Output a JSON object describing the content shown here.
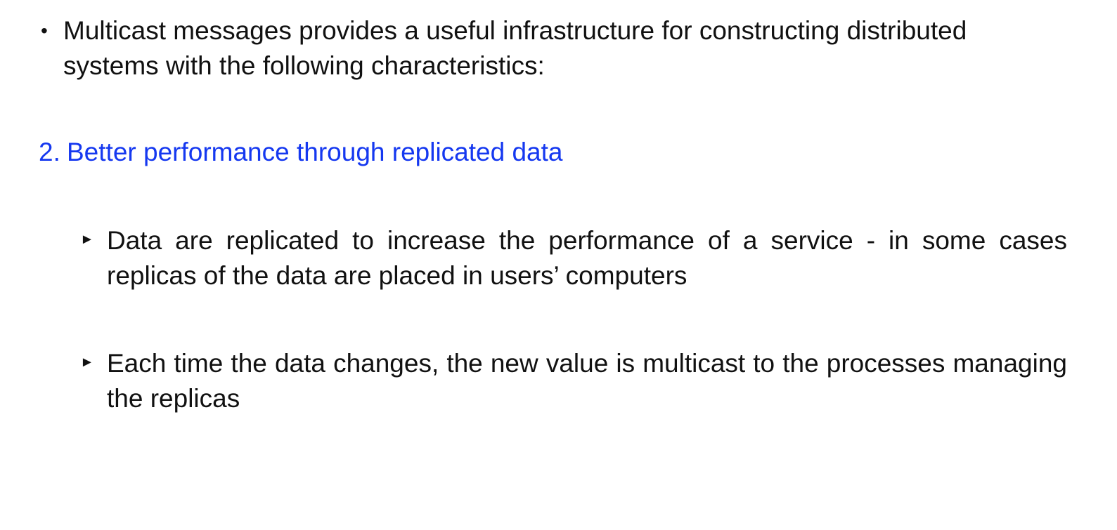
{
  "colors": {
    "text": "#111111",
    "heading": "#1538f0",
    "background": "#ffffff"
  },
  "intro": {
    "bullet": "•",
    "text": "Multicast messages provides a useful infrastructure for constructing distributed systems with the following characteristics:"
  },
  "section": {
    "number": "2.",
    "title": "Better performance through replicated data"
  },
  "points": [
    {
      "marker": "►",
      "text": "Data are replicated to increase the performance of a service - in some cases replicas of the data are placed in users’ computers"
    },
    {
      "marker": "►",
      "text": "Each time the data changes, the new value is multicast to the processes managing the replicas"
    }
  ]
}
